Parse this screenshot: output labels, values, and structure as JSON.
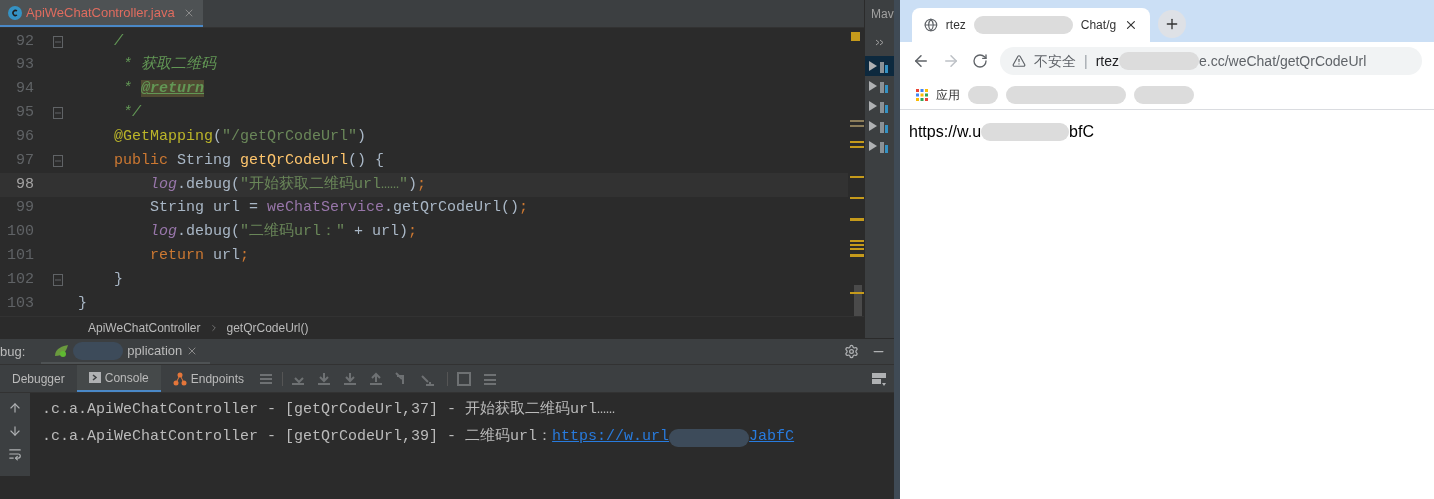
{
  "editor": {
    "tab": {
      "label": "ApiWeChatController.java",
      "selected": true
    },
    "lines": [
      {
        "number": "92",
        "fold": true,
        "current": false,
        "tokens": [
          {
            "kind": "comment",
            "text": "    /"
          }
        ]
      },
      {
        "number": "93",
        "fold": false,
        "current": false,
        "tokens": [
          {
            "kind": "comment",
            "text": "     * 获取二维码"
          }
        ]
      },
      {
        "number": "94",
        "fold": false,
        "current": false,
        "tokens": [
          {
            "kind": "comment",
            "text": "     * "
          },
          {
            "kind": "doctag",
            "text": "@return"
          }
        ]
      },
      {
        "number": "95",
        "fold": true,
        "current": false,
        "tokens": [
          {
            "kind": "comment",
            "text": "     */"
          }
        ]
      },
      {
        "number": "96",
        "fold": false,
        "current": false,
        "tokens": [
          {
            "kind": "annotation",
            "text": "    @GetMapping"
          },
          {
            "kind": "plain",
            "text": "("
          },
          {
            "kind": "string",
            "text": "\"/getQrCodeUrl\""
          },
          {
            "kind": "plain",
            "text": ")"
          }
        ]
      },
      {
        "number": "97",
        "fold": true,
        "current": false,
        "tokens": [
          {
            "kind": "keyword",
            "text": "    public"
          },
          {
            "kind": "plain",
            "text": " String "
          },
          {
            "kind": "method",
            "text": "getQrCodeUrl"
          },
          {
            "kind": "plain",
            "text": "() {"
          }
        ]
      },
      {
        "number": "98",
        "fold": false,
        "current": true,
        "tokens": [
          {
            "kind": "static",
            "text": "        log"
          },
          {
            "kind": "plain",
            "text": ".debug("
          },
          {
            "kind": "string",
            "text": "\"开始获取二维码url……\""
          },
          {
            "kind": "plain",
            "text": ")"
          },
          {
            "kind": "keyword",
            "text": ";"
          }
        ]
      },
      {
        "number": "99",
        "fold": false,
        "current": false,
        "tokens": [
          {
            "kind": "plain",
            "text": "        String url = "
          },
          {
            "kind": "field",
            "text": "weChatService"
          },
          {
            "kind": "plain",
            "text": ".getQrCodeUrl()"
          },
          {
            "kind": "keyword",
            "text": ";"
          }
        ]
      },
      {
        "number": "100",
        "fold": false,
        "current": false,
        "tokens": [
          {
            "kind": "static",
            "text": "        log"
          },
          {
            "kind": "plain",
            "text": ".debug("
          },
          {
            "kind": "string",
            "text": "\"二维码url：\""
          },
          {
            "kind": "plain",
            "text": " + url)"
          },
          {
            "kind": "keyword",
            "text": ";"
          }
        ]
      },
      {
        "number": "101",
        "fold": false,
        "current": false,
        "tokens": [
          {
            "kind": "keyword",
            "text": "        return"
          },
          {
            "kind": "plain",
            "text": " url"
          },
          {
            "kind": "keyword",
            "text": ";"
          }
        ]
      },
      {
        "number": "102",
        "fold": true,
        "current": false,
        "tokens": [
          {
            "kind": "plain",
            "text": "    }"
          }
        ]
      },
      {
        "number": "103",
        "fold": false,
        "current": false,
        "tokens": [
          {
            "kind": "plain",
            "text": "}"
          }
        ]
      }
    ],
    "breadcrumbs": [
      "ApiWeChatController",
      "getQrCodeUrl()"
    ]
  },
  "maven_panel": {
    "title": "Mav",
    "rows": [
      {
        "selected": true
      },
      {
        "selected": false
      },
      {
        "selected": false
      },
      {
        "selected": false
      },
      {
        "selected": false
      }
    ]
  },
  "debug": {
    "label": "bug:",
    "session": "pplication",
    "tabs": [
      {
        "label": "Debugger",
        "selected": false,
        "kind": "plain"
      },
      {
        "label": "Console",
        "selected": true,
        "kind": "console"
      },
      {
        "label": "Endpoints",
        "selected": false,
        "kind": "endpoints"
      }
    ],
    "console_lines": [
      {
        "text": ".c.a.ApiWeChatController - [getQrCodeUrl,37] - 开始获取二维码url……"
      },
      {
        "text": ".c.a.ApiWeChatController - [getQrCodeUrl,39] - 二维码url：",
        "link_start": "https://w.url",
        "link_end": "JabfC"
      }
    ]
  },
  "browser": {
    "tab": {
      "title_start": "rtez",
      "title_end": "Chat/g"
    },
    "address": {
      "security": "不安全",
      "separator": "|",
      "url_start": "rtez",
      "url_end": "e.cc/weChat/getQrCodeUrl"
    },
    "bookmarks": {
      "apps": "应用"
    },
    "content": {
      "text_start": "https://w.u",
      "text_end": "bfC"
    }
  }
}
